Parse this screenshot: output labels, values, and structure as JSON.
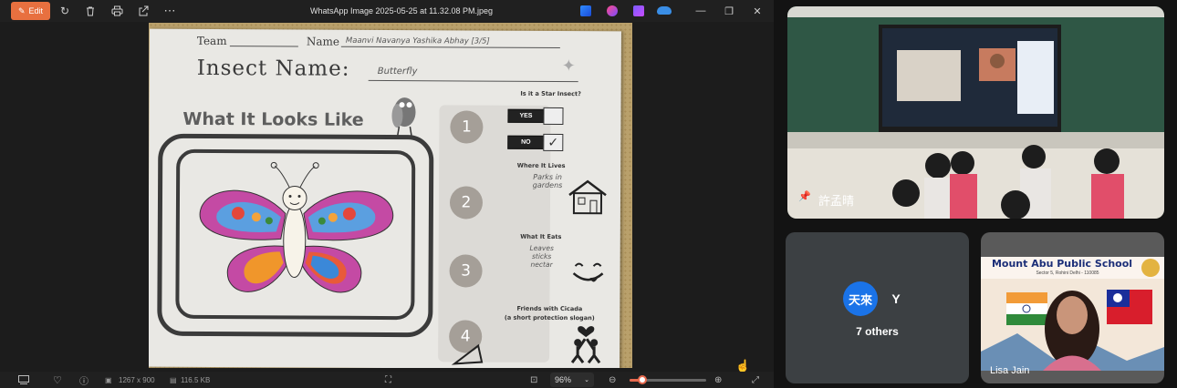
{
  "viewer": {
    "edit_label": "Edit",
    "file_title": "WhatsApp Image 2025-05-25 at 11.32.08 PM.jpeg",
    "dimensions": "1267 x 900",
    "file_size": "116.5 KB",
    "zoom_level": "96%",
    "zoom_slider_fraction": 0.17
  },
  "worksheet": {
    "team_label": "Team",
    "name_label": "Name",
    "names_handwritten": "Maanvi  Navanya  Yashika  Abhay  [3/5]",
    "insect_name_label": "Insect Name:",
    "insect_name_value": "Butterfly",
    "looks_like_title": "What It Looks Like",
    "q_star_insect": "Is it a Star Insect?",
    "yes": "YES",
    "no": "NO",
    "q_where_lives": "Where It Lives",
    "where_answer": "Parks in gardens",
    "q_what_eats": "What It Eats",
    "eats_answer": "Leaves sticks nectar",
    "q_friends": "Friends with Cicada",
    "q_friends_sub": "(a short protection slogan)",
    "numbers": [
      "1",
      "2",
      "3",
      "4"
    ]
  },
  "meeting": {
    "classroom_name": "許孟晴",
    "others_avatars": [
      {
        "initials": "天來",
        "color": "#1a73e8"
      },
      {
        "initials": "Y",
        "color": "#0b8043"
      }
    ],
    "others_label": "7 others",
    "speaker_name": "Lisa Jain",
    "school_name": "Mount Abu Public School",
    "school_address": "Sector 5, Rohini Delhi - 110085"
  }
}
